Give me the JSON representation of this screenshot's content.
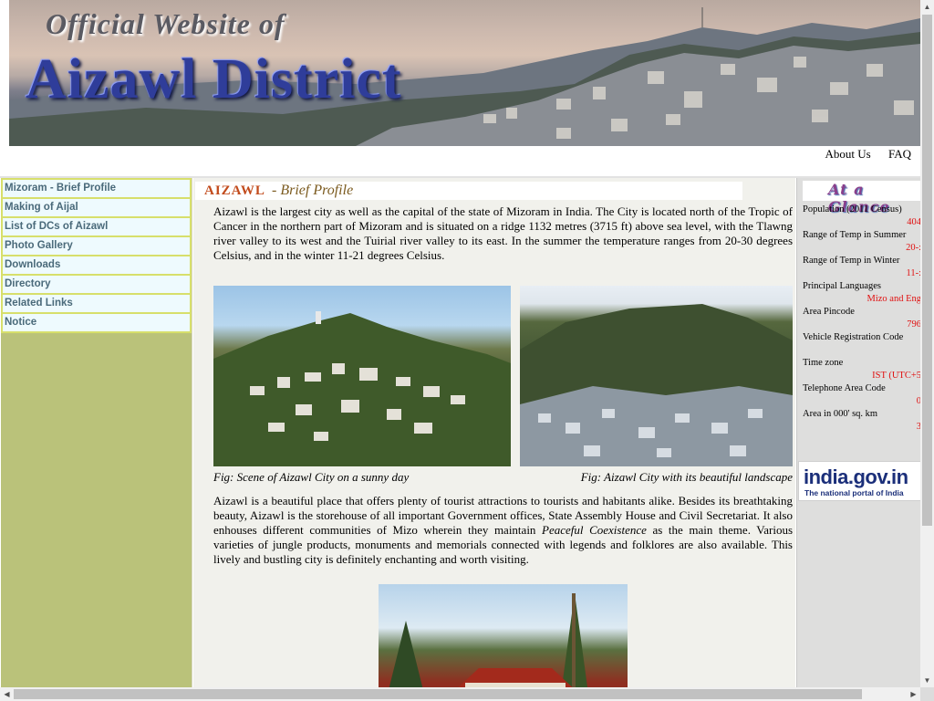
{
  "banner": {
    "title_line1": "Official Website of",
    "title_line2": "Aizawl District"
  },
  "top_links": [
    "About Us",
    "FAQ"
  ],
  "left_nav": [
    "Mizoram - Brief Profile",
    "Making of Aijal",
    "List of DCs of Aizawl",
    "Photo Gallery",
    "Downloads",
    "Directory",
    "Related Links",
    "Notice"
  ],
  "main": {
    "heading_primary": "AIZAWL",
    "heading_secondary": "- Brief Profile",
    "paragraph1": "Aizawl is the largest city as well as the capital of the state of Mizoram in India. The City is located north of the Tropic of Cancer in the northern part of Mizoram and is situated on a ridge 1132 metres (3715 ft) above sea level, with the Tlawng river valley to its west and the Tuirial river valley to its east. In the summer the temperature ranges from 20-30 degrees Celsius, and in the winter 11-21 degrees Celsius.",
    "caption1": "Fig: Scene of Aizawl City on a sunny day",
    "caption2": "Fig: Aizawl City with its beautiful landscape",
    "paragraph2_part1": "Aizawl is a beautiful place that offers plenty of tourist attractions to tourists and habitants alike. Besides its breathtaking beauty, Aizawl is the storehouse of all important Government offices, State Assembly House and Civil Secretariat. It also enhouses different communities of Mizo wherein they maintain ",
    "paragraph2_emphasis": "Peaceful Coexistence",
    "paragraph2_part2": " as the main theme. Various varieties of jungle products, monuments and memorials connected with legends and folklores are also available. This lively and bustling city is definitely enchanting and worth visiting."
  },
  "at_a_glance": {
    "title": "At a Glance",
    "facts": [
      {
        "label": "Population (2011 Census)",
        "value": "404"
      },
      {
        "label": "Range of Temp in Summer",
        "value": "20-:"
      },
      {
        "label": "Range of Temp in Winter",
        "value": "11-:"
      },
      {
        "label": "Principal Languages",
        "value": "Mizo and Eng"
      },
      {
        "label": "Area Pincode",
        "value": "796"
      },
      {
        "label": "Vehicle Registration Code",
        "value": ""
      },
      {
        "label": "Time zone",
        "value": "IST (UTC+5"
      },
      {
        "label": "Telephone Area Code",
        "value": "0"
      },
      {
        "label": "Area in 000' sq. km",
        "value": "3"
      }
    ]
  },
  "portal": {
    "name": "india.gov.in",
    "tagline": "The national portal of India"
  },
  "colors": {
    "nav_bg": "#bac27a",
    "nav_item_bg": "#eefafe",
    "heading_red": "#c24b1c",
    "fact_value_red": "#e01010",
    "banner_title_blue": "#2f3d9a"
  }
}
